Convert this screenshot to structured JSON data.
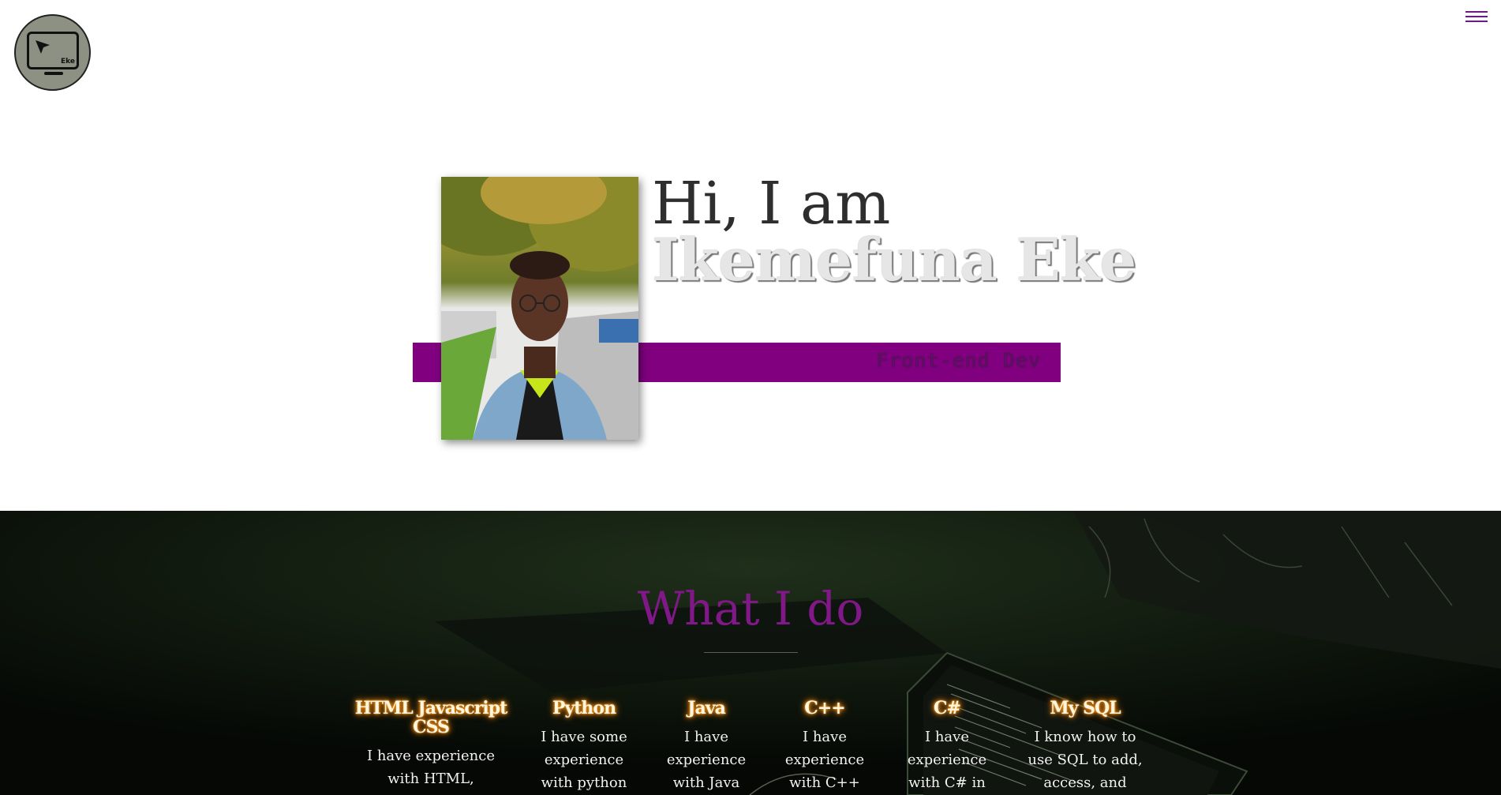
{
  "logo": {
    "brand": "Eke",
    "icon": "monitor-cursor-icon"
  },
  "menu": {
    "icon": "hamburger-menu-icon"
  },
  "hero": {
    "greeting": "Hi, I am",
    "name": "Ikemefuna Eke",
    "role": "Front-end Dev",
    "accent_color": "#800080"
  },
  "what_i_do": {
    "title": "What I do",
    "skills": [
      {
        "title": "HTML Javascript CSS",
        "desc": "I have experience with HTML, Javascript and"
      },
      {
        "title": "Python",
        "desc": "I have some experience with python"
      },
      {
        "title": "Java",
        "desc": "I have experience with Java"
      },
      {
        "title": "C++",
        "desc": "I have experience with C++ and"
      },
      {
        "title": "C#",
        "desc": "I have experience with C# in"
      },
      {
        "title": "My SQL",
        "desc": "I know how to use SQL to add, access, and"
      }
    ]
  }
}
